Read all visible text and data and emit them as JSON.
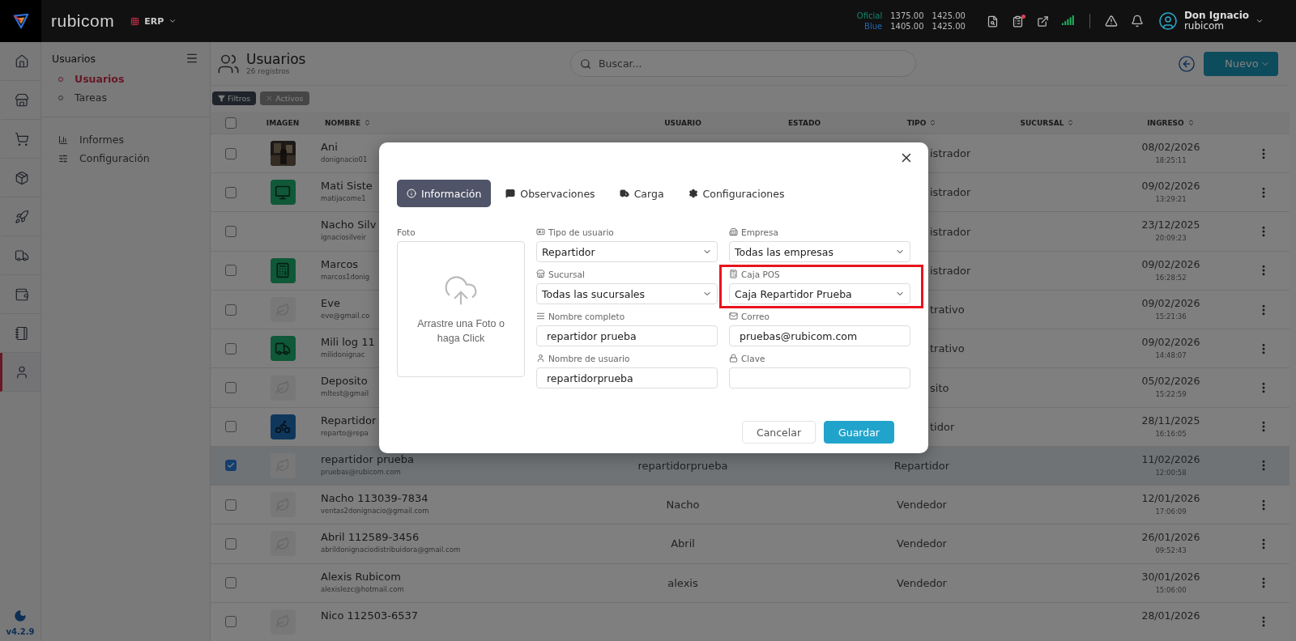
{
  "app": {
    "logo_text": "rubicom",
    "module": "ERP"
  },
  "rates": [
    {
      "label": "Oficial",
      "buy": "1375.00",
      "sell": "1425.00",
      "color": "#12876f"
    },
    {
      "label": "Blue",
      "buy": "1405.00",
      "sell": "1425.00",
      "color": "#2266b4"
    }
  ],
  "tools": [
    {
      "kind": "doc-search",
      "badge": false
    },
    {
      "kind": "clipboard",
      "badge": true
    },
    {
      "kind": "external",
      "badge": false
    },
    {
      "kind": "signal",
      "badge": false
    }
  ],
  "alerts": [
    {
      "kind": "warning",
      "badge": false
    },
    {
      "kind": "bell",
      "badge": false
    }
  ],
  "user": {
    "name": "Don Ignacio",
    "company": "rubicom"
  },
  "rail": [
    {
      "kind": "home",
      "selected": false
    },
    {
      "kind": "store",
      "selected": false
    },
    {
      "kind": "cart",
      "selected": false
    },
    {
      "kind": "package",
      "selected": false
    },
    {
      "kind": "rocket",
      "selected": false
    },
    {
      "kind": "truck",
      "selected": false
    },
    {
      "kind": "wallet",
      "selected": false
    },
    {
      "kind": "book",
      "selected": false
    },
    {
      "kind": "user",
      "selected": true
    }
  ],
  "version": "v4.2.9",
  "subnav": {
    "title": "Usuarios",
    "items": [
      {
        "label": "Usuarios",
        "selected": true
      },
      {
        "label": "Tareas",
        "selected": false
      }
    ],
    "links": [
      {
        "kind": "chart",
        "label": "Informes"
      },
      {
        "kind": "sliders",
        "label": "Configuración"
      }
    ]
  },
  "page": {
    "title": "Usuarios",
    "count": "26 registros",
    "search_placeholder": "Buscar...",
    "new_button": "Nuevo"
  },
  "filters": [
    {
      "kind": "filter",
      "label": "Filtros"
    },
    {
      "kind": "clear",
      "label": "Activos"
    }
  ],
  "table": {
    "all_checked": false,
    "columns": [
      {
        "label": "IMAGEN",
        "sortable": false
      },
      {
        "label": "NOMBRE",
        "sortable": true
      },
      {
        "label": "USUARIO",
        "sortable": false
      },
      {
        "label": "ESTADO",
        "sortable": false
      },
      {
        "label": "TIPO",
        "sortable": true
      },
      {
        "label": "SUCURSAL",
        "sortable": true
      },
      {
        "label": "INGRESO",
        "sortable": true
      }
    ],
    "rows": [
      {
        "name": "Ani",
        "email": "donignacio01",
        "type": "istrador",
        "type_cut": true,
        "date": "08/02/2026",
        "time": "18:25:11",
        "selected": false
      },
      {
        "kind": "monitor",
        "name": "Mati Siste",
        "email": "matijacome1",
        "type": "istrador",
        "type_cut": true,
        "date": "09/02/2026",
        "time": "13:29:21",
        "selected": false
      },
      {
        "kind": "none",
        "name": "Nacho Silv",
        "email": "ignaciosilveir",
        "type": "istrador",
        "type_cut": true,
        "date": "23/12/2025",
        "time": "20:09:23",
        "selected": false
      },
      {
        "kind": "register",
        "name": "Marcos",
        "email": "marcos1donig",
        "type": "istrador",
        "type_cut": true,
        "date": "09/02/2026",
        "time": "16:28:52",
        "selected": false
      },
      {
        "kind": "placeholder",
        "name": "Eve",
        "email": "eve@gmail.co",
        "type": "trativo",
        "type_cut": true,
        "date": "09/02/2026",
        "time": "15:21:36",
        "selected": false
      },
      {
        "kind": "truck",
        "name": "Mili log 11",
        "email": "milidonignac",
        "type": "trativo",
        "type_cut": true,
        "date": "09/02/2026",
        "time": "14:48:07",
        "selected": false
      },
      {
        "kind": "placeholder",
        "name": "Deposito",
        "email": "mltest@gmail",
        "type": "sito",
        "type_cut": true,
        "date": "05/02/2026",
        "time": "15:22:59",
        "selected": false
      },
      {
        "kind": "scooter",
        "name": "Repartidor",
        "email": "reparto@repa",
        "type": "tidor",
        "type_cut": true,
        "date": "28/11/2025",
        "time": "16:16:05",
        "selected": false
      },
      {
        "kind": "placeholder",
        "name": "repartidor prueba",
        "email": "pruebas@rubicom.com",
        "user": "repartidorprueba",
        "type": "Repartidor",
        "type_cut": false,
        "date": "11/02/2026",
        "time": "12:00:58",
        "selected": true
      },
      {
        "kind": "placeholder",
        "name": "Nacho 113039-7834",
        "email": "ventas2donignacio@gmail.com",
        "user": "Nacho",
        "type": "Vendedor",
        "type_cut": false,
        "date": "12/01/2026",
        "time": "17:06:09",
        "selected": false
      },
      {
        "kind": "placeholder",
        "name": "Abril 112589-3456",
        "email": "abrildonignaciodistribuidora@gmail.com",
        "user": "Abril",
        "type": "Vendedor",
        "type_cut": false,
        "date": "26/01/2026",
        "time": "09:52:43",
        "selected": false
      },
      {
        "kind": "none",
        "name": "Alexis Rubicom",
        "email": "alexislezc@hotmail.com",
        "user": "alexis",
        "type": "Vendedor",
        "type_cut": false,
        "date": "30/01/2026",
        "time": "15:06:00",
        "selected": false
      },
      {
        "kind": "placeholder",
        "name": "Nico 112503-6537",
        "date": "28/01/2026",
        "selected": false
      }
    ]
  },
  "modal": {
    "tabs": [
      {
        "kind": "info",
        "label": "Información",
        "selected": true
      },
      {
        "kind": "notes",
        "label": "Observaciones",
        "selected": false
      },
      {
        "kind": "truck",
        "label": "Carga",
        "selected": false
      },
      {
        "kind": "gear",
        "label": "Configuraciones",
        "selected": false
      }
    ],
    "photo": {
      "label": "Foto",
      "hint": "Arrastre una Foto o haga Click"
    },
    "fields": [
      {
        "kind": "select",
        "label": "Tipo de usuario",
        "value": "Repartidor",
        "highlighted": false
      },
      {
        "kind": "select",
        "label": "Empresa",
        "value": "Todas las empresas",
        "highlighted": false
      },
      {
        "kind": "select",
        "label": "Sucursal",
        "value": "Todas las sucursales",
        "highlighted": false
      },
      {
        "kind": "select",
        "label": "Caja POS",
        "value": "Caja Repartidor Prueba",
        "highlighted": true
      },
      {
        "kind": "text",
        "label": "Nombre completo",
        "value": "repartidor prueba",
        "highlighted": false
      },
      {
        "kind": "text",
        "label": "Correo",
        "value": "pruebas@rubicom.com",
        "highlighted": false
      },
      {
        "kind": "text",
        "label": "Nombre de usuario",
        "value": "repartidorprueba",
        "highlighted": false
      },
      {
        "kind": "password",
        "label": "Clave",
        "highlighted": false
      }
    ],
    "buttons": [
      {
        "kind": "secondary",
        "label": "Cancelar"
      },
      {
        "kind": "primary",
        "label": "Guardar"
      }
    ]
  }
}
